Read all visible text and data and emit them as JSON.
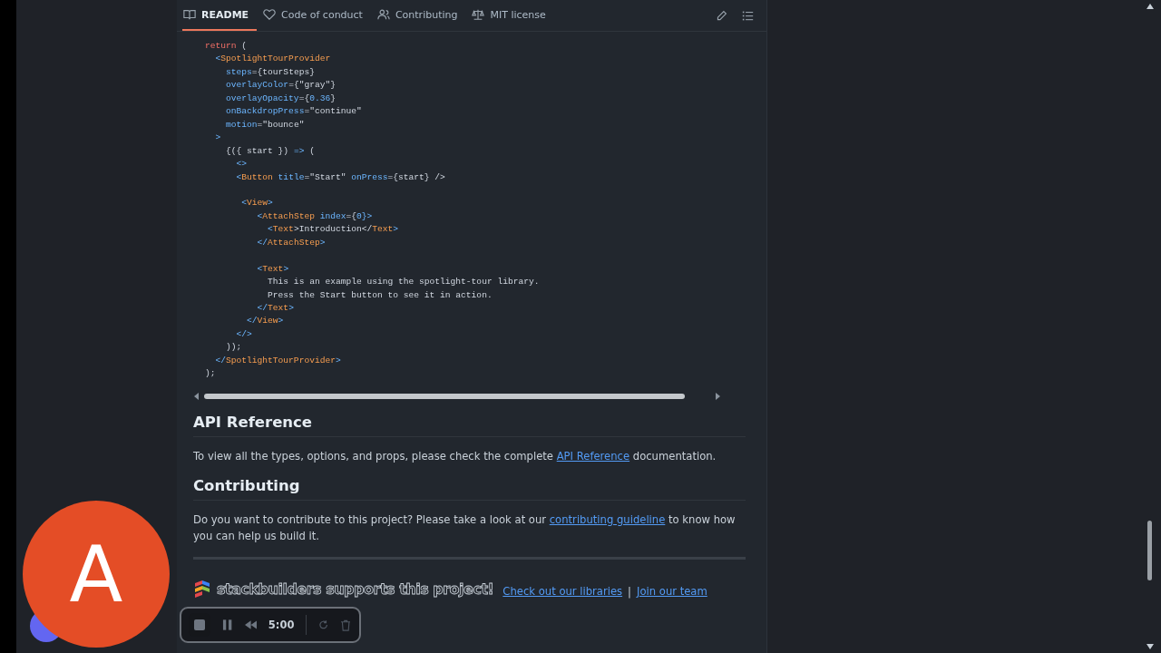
{
  "tabs": [
    {
      "label": "README",
      "selected": true
    },
    {
      "label": "Code of conduct",
      "selected": false
    },
    {
      "label": "Contributing",
      "selected": false
    },
    {
      "label": "MIT license",
      "selected": false
    }
  ],
  "code_lines": [
    {
      "tokens": [
        {
          "t": "return",
          "kind": "kw"
        },
        {
          "t": " (",
          "kind": "text"
        }
      ]
    },
    {
      "tokens": [
        {
          "t": "  <",
          "kind": "punct"
        },
        {
          "t": "SpotlightTourProvider",
          "kind": "tag"
        }
      ]
    },
    {
      "tokens": [
        {
          "t": "    steps",
          "kind": "attr"
        },
        {
          "t": "={tourSteps}",
          "kind": "text"
        }
      ]
    },
    {
      "tokens": [
        {
          "t": "    overlayColor",
          "kind": "attr"
        },
        {
          "t": "={\"gray\"}",
          "kind": "text"
        }
      ]
    },
    {
      "tokens": [
        {
          "t": "    overlayOpacity",
          "kind": "attr"
        },
        {
          "t": "={",
          "kind": "text"
        },
        {
          "t": "0.36",
          "kind": "attr"
        },
        {
          "t": "}",
          "kind": "text"
        }
      ]
    },
    {
      "tokens": [
        {
          "t": "    onBackdropPress",
          "kind": "attr"
        },
        {
          "t": "=\"continue\"",
          "kind": "text"
        }
      ]
    },
    {
      "tokens": [
        {
          "t": "    motion",
          "kind": "attr"
        },
        {
          "t": "=\"bounce\"",
          "kind": "text"
        }
      ]
    },
    {
      "tokens": [
        {
          "t": "  >",
          "kind": "punct"
        }
      ]
    },
    {
      "tokens": [
        {
          "t": "    {({ start }) ",
          "kind": "text"
        },
        {
          "t": "=>",
          "kind": "punct"
        },
        {
          "t": " (",
          "kind": "text"
        }
      ]
    },
    {
      "tokens": [
        {
          "t": "      <>",
          "kind": "punct"
        }
      ]
    },
    {
      "tokens": [
        {
          "t": "      <",
          "kind": "punct"
        },
        {
          "t": "Button",
          "kind": "tag"
        },
        {
          "t": " title",
          "kind": "attr"
        },
        {
          "t": "=\"Start\" ",
          "kind": "text"
        },
        {
          "t": "onPress",
          "kind": "attr"
        },
        {
          "t": "={start} />",
          "kind": "text"
        }
      ]
    },
    {
      "gap_before": true,
      "tokens": [
        {
          "t": "       <",
          "kind": "punct"
        },
        {
          "t": "View",
          "kind": "tag"
        },
        {
          "t": ">",
          "kind": "punct"
        }
      ]
    },
    {
      "tokens": [
        {
          "t": "          <",
          "kind": "punct"
        },
        {
          "t": "AttachStep",
          "kind": "tag"
        },
        {
          "t": " index",
          "kind": "attr"
        },
        {
          "t": "={",
          "kind": "text"
        },
        {
          "t": "0",
          "kind": "attr"
        },
        {
          "t": "}>",
          "kind": "punct"
        }
      ]
    },
    {
      "tokens": [
        {
          "t": "            <",
          "kind": "punct"
        },
        {
          "t": "Text",
          "kind": "tag"
        },
        {
          "t": ">Introduction</",
          "kind": "text"
        },
        {
          "t": "Text",
          "kind": "tag"
        },
        {
          "t": ">",
          "kind": "punct"
        }
      ]
    },
    {
      "tokens": [
        {
          "t": "          </",
          "kind": "punct"
        },
        {
          "t": "AttachStep",
          "kind": "tag"
        },
        {
          "t": ">",
          "kind": "punct"
        }
      ]
    },
    {
      "gap_before": true,
      "tokens": [
        {
          "t": "          <",
          "kind": "punct"
        },
        {
          "t": "Text",
          "kind": "tag"
        },
        {
          "t": ">",
          "kind": "punct"
        }
      ]
    },
    {
      "tokens": [
        {
          "t": "            This is an example using the spotlight-tour library.",
          "kind": "text"
        }
      ]
    },
    {
      "tokens": [
        {
          "t": "            Press the Start button to see it in action.",
          "kind": "text"
        }
      ]
    },
    {
      "tokens": [
        {
          "t": "          </",
          "kind": "punct"
        },
        {
          "t": "Text",
          "kind": "tag"
        },
        {
          "t": ">",
          "kind": "punct"
        }
      ]
    },
    {
      "tokens": [
        {
          "t": "        </",
          "kind": "punct"
        },
        {
          "t": "View",
          "kind": "tag"
        },
        {
          "t": ">",
          "kind": "punct"
        }
      ]
    },
    {
      "tokens": [
        {
          "t": "      </>",
          "kind": "punct"
        }
      ]
    },
    {
      "tokens": [
        {
          "t": "    ));",
          "kind": "text"
        }
      ]
    },
    {
      "tokens": [
        {
          "t": "  </",
          "kind": "punct"
        },
        {
          "t": "SpotlightTourProvider",
          "kind": "tag"
        },
        {
          "t": ">",
          "kind": "punct"
        }
      ]
    },
    {
      "tokens": [
        {
          "t": ");",
          "kind": "text"
        }
      ]
    }
  ],
  "sections": [
    {
      "heading": "API Reference",
      "paragraph": [
        {
          "t": "To view all the types, options, and props, please check the complete ",
          "kind": "text"
        },
        {
          "t": "API Reference",
          "kind": "link"
        },
        {
          "t": " documentation.",
          "kind": "text"
        }
      ]
    },
    {
      "heading": "Contributing",
      "paragraph": [
        {
          "t": "Do you want to contribute to this project? Please take a look at our ",
          "kind": "text"
        },
        {
          "t": "contributing guideline",
          "kind": "link"
        },
        {
          "t": " to know how you can help us build it.",
          "kind": "text"
        }
      ]
    }
  ],
  "sponsor": {
    "banner": "stackbuilders supports this project!",
    "links": [
      "Check out our libraries",
      "Join our team"
    ],
    "separator": "|"
  },
  "avatar": {
    "letter": "A"
  },
  "recorder": {
    "timer": "5:00"
  }
}
